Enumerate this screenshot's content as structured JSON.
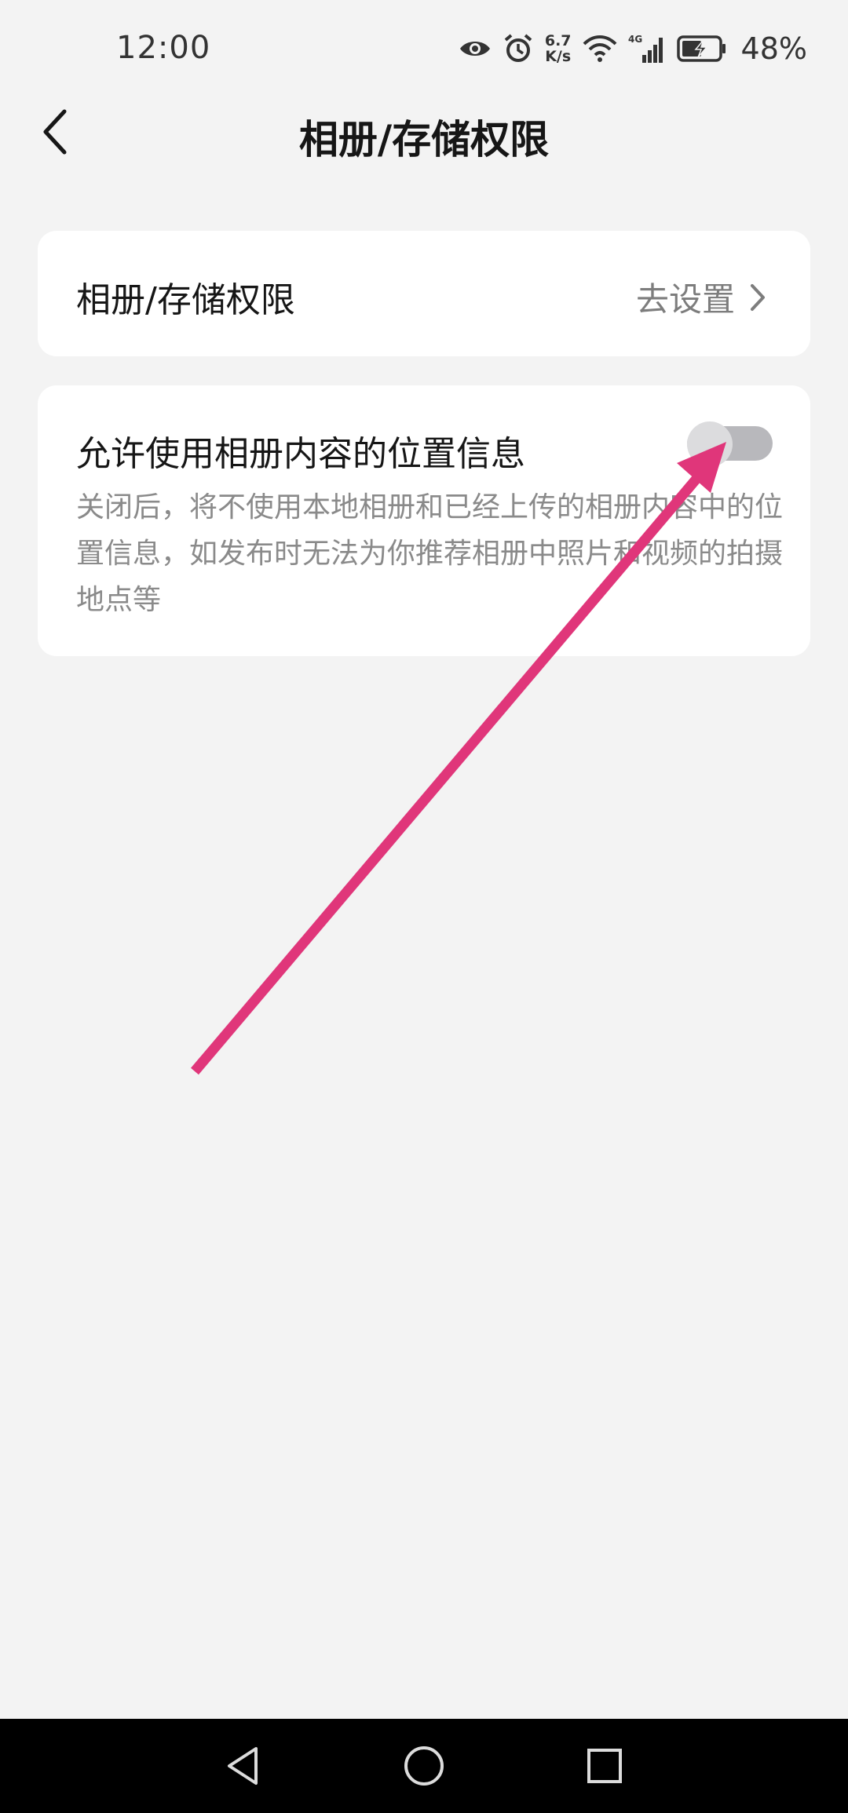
{
  "status_bar": {
    "time": "12:00",
    "net_speed_value": "6.7",
    "net_speed_unit": "K/s",
    "battery_percent": "48%",
    "icons": [
      "eye-icon",
      "alarm-icon",
      "wifi-icon",
      "signal-4g-icon",
      "battery-charging-icon"
    ]
  },
  "header": {
    "title": "相册/存储权限",
    "back_icon": "chevron-left-icon"
  },
  "permission_row": {
    "label": "相册/存储权限",
    "action_label": "去设置",
    "action_icon": "chevron-right-icon"
  },
  "location_setting": {
    "title": "允许使用相册内容的位置信息",
    "description": "关闭后，将不使用本地相册和已经上传的相册内容中的位置信息，如发布时无法为你推荐相册中照片和视频的拍摄地点等",
    "toggle_state": "off"
  },
  "annotation": {
    "color": "#e0367a",
    "icon": "arrow-icon"
  },
  "nav_bar": {
    "icons": [
      "nav-back-icon",
      "nav-home-icon",
      "nav-recent-icon"
    ]
  }
}
